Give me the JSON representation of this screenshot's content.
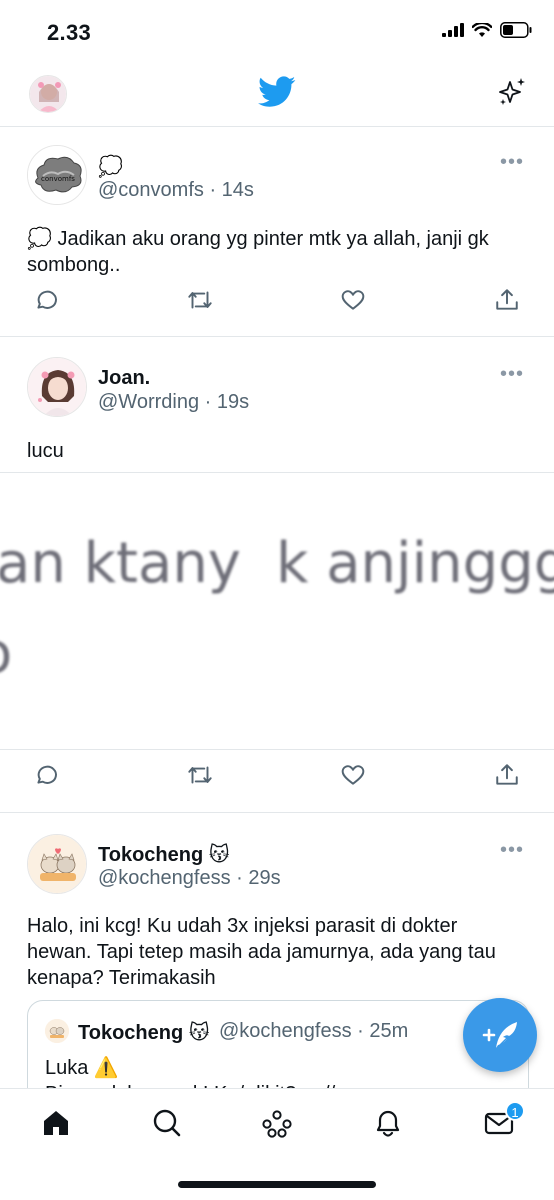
{
  "status_bar": {
    "time": "2.33"
  },
  "tweets": [
    {
      "name": "💭",
      "handle": "@convomfs · 14s",
      "text_line1": "💭 Jadikan aku orang yg pinter mtk ya allah, janji gk",
      "text_line2": "sombong..",
      "avatar_label": "convomfs"
    },
    {
      "name": "Joan.",
      "handle": "@Worrding · 19s",
      "text_line1": "lucu",
      "media_text_1": "an ktany",
      "media_text_2": "k anjingggg",
      "media_text_3": "o"
    },
    {
      "name": "Tokocheng 😽",
      "handle": "@kochengfess · 29s",
      "text_line1": "Halo, ini kcg! Ku udah 3x injeksi parasit di dokter",
      "text_line2": "hewan. Tapi tetep masih ada jamurnya, ada yang tau",
      "text_line3": "kenapa? Terimakasih",
      "quote": {
        "name": "Tokocheng 😽",
        "handle": "@kochengfess · 25m",
        "text": "Luka ⚠️",
        "text2": "Bisa ngk ke... nak! Ku/ dikit? ... // ..."
      }
    }
  ],
  "bottom_nav": {
    "items": [
      "home-icon",
      "search-icon",
      "spaces-icon",
      "notifications-icon",
      "messages-icon"
    ],
    "message_badge": "1"
  },
  "colors": {
    "accent": "#1d9bf0",
    "fab": "#3a99e8",
    "secondary_text": "#536471"
  }
}
